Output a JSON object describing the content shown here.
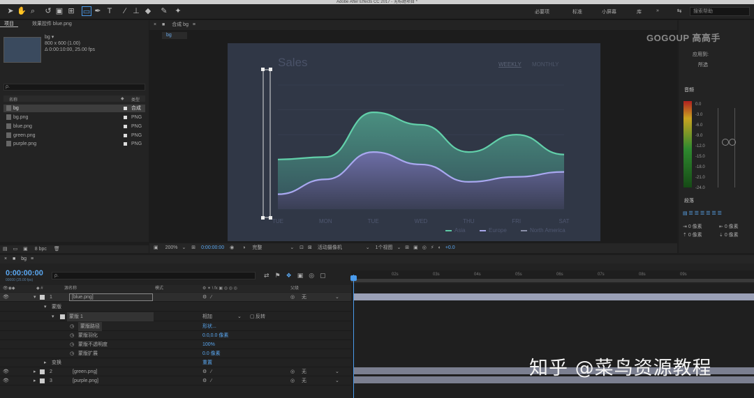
{
  "app": {
    "title": "Adobe After Effects CC 2017 - 无标题项目 *"
  },
  "workspaces": [
    "必要项",
    "标准",
    "小屏幕",
    "库"
  ],
  "search": {
    "placeholder": "搜索帮助"
  },
  "project": {
    "tabs": [
      "项目",
      "效果控件 blue.png"
    ],
    "selected_name": "bg ▾",
    "selected_info1": "800 x 600 (1.00)",
    "selected_info2": "Δ 0:00:10:00, 25.00 fps",
    "search_placeholder": "ρ.",
    "col_name": "名称",
    "col_type": "类型",
    "files": [
      {
        "name": "bg",
        "type": "合成"
      },
      {
        "name": "bg.png",
        "type": "PNG"
      },
      {
        "name": "blue.png",
        "type": "PNG"
      },
      {
        "name": "green.png",
        "type": "PNG"
      },
      {
        "name": "purple.png",
        "type": "PNG"
      }
    ],
    "bpc": "8 bpc"
  },
  "viewer": {
    "comp_tab": "合成 bg",
    "sub_tab": "bg",
    "zoom": "200%",
    "time": "0:00:00:00",
    "quality": "完整",
    "camera": "活动摄像机",
    "views": "1个视图",
    "exposure": "+0.0"
  },
  "chart_data": {
    "type": "area",
    "title": "Sales",
    "toggle": [
      "WEEKLY",
      "MONTHLY"
    ],
    "categories": [
      "TUE",
      "MON",
      "TUE",
      "WED",
      "THU",
      "FRI",
      "SAT"
    ],
    "series": [
      {
        "name": "Asia",
        "color": "#5fc9a6",
        "values": [
          40,
          42,
          78,
          68,
          46,
          60,
          44
        ]
      },
      {
        "name": "Europe",
        "color": "#a7a6e8",
        "values": [
          12,
          24,
          46,
          36,
          22,
          26,
          30
        ]
      },
      {
        "name": "North America",
        "color": "#8a8fa8",
        "values": []
      }
    ],
    "ylim": [
      0,
      100
    ]
  },
  "right_panel": {
    "logo": "GOGOUP 高高手",
    "labels": [
      "应用到:",
      "所选",
      "音频",
      "段落"
    ],
    "meter_values": [
      "0.0",
      "-3.0",
      "-6.0",
      "-9.0",
      "-12.0",
      "-15.0",
      "-18.0",
      "-21.0",
      "-24.0"
    ],
    "para_vals": [
      "0 像素",
      "0 像素",
      "0 像素",
      "0 像素",
      "0 像素"
    ]
  },
  "timeline": {
    "tab": "bg",
    "timecode": "0:00:00:00",
    "fps": "00000 (25.00 fps)",
    "search_placeholder": "ρ.",
    "col_source": "源名称",
    "col_mode": "模式",
    "col_parent": "父级",
    "ruler": [
      "02s",
      "03s",
      "04s",
      "05s",
      "06s",
      "07s",
      "08s",
      "09s"
    ],
    "layers": [
      {
        "num": "1",
        "name": "[blue.png]",
        "parent": "无"
      },
      {
        "num": "2",
        "name": "[green.png]",
        "parent": "无"
      },
      {
        "num": "3",
        "name": "[purple.png]",
        "parent": "无"
      }
    ],
    "props": {
      "masks": "蒙版",
      "mask1": "蒙版 1",
      "mask_mode": "相加",
      "mask_invert": "反转",
      "mask_path": "蒙版路径",
      "mask_path_val": "形状...",
      "feather": "蒙版羽化",
      "feather_val": "0.0,0.0 像素",
      "opacity": "蒙版不透明度",
      "opacity_val": "100%",
      "expansion": "蒙版扩展",
      "expansion_val": "0.0 像素",
      "transform": "变换",
      "transform_val": "重置"
    }
  },
  "watermark": "知乎 @菜鸟资源教程"
}
